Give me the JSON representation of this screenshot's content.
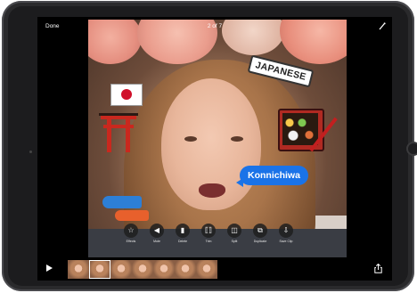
{
  "topbar": {
    "done_label": "Done",
    "counter": "2 of 7"
  },
  "photo": {
    "sticker_text": "JAPANESE",
    "bubble_text": "Konnichiwa"
  },
  "toolbar": {
    "items": [
      {
        "label": "Effects",
        "icon": "star-icon"
      },
      {
        "label": "Mute",
        "icon": "speaker-icon"
      },
      {
        "label": "Delete",
        "icon": "trash-icon"
      },
      {
        "label": "Trim",
        "icon": "trim-icon"
      },
      {
        "label": "Split",
        "icon": "split-icon"
      },
      {
        "label": "Duplicate",
        "icon": "duplicate-icon"
      },
      {
        "label": "Save Clip",
        "icon": "save-icon"
      }
    ]
  },
  "bottombar": {
    "frame_count": 7,
    "selected_frame": 2
  },
  "colors": {
    "bubble": "#1a73e8",
    "sticker_border": "#333333"
  }
}
